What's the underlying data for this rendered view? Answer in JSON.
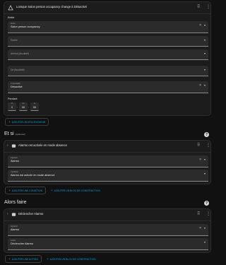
{
  "triggers": {
    "card_title": "Lorsque Salon person occupancy change à Désactivé",
    "entity_label": "Entité",
    "entity_field": {
      "label": "Entité",
      "value": "Salon person occupancy"
    },
    "from_field": {
      "placeholder": "Entrée"
    },
    "attribute_field": {
      "placeholder": "Attribut (facultatif)"
    },
    "de_field": {
      "placeholder": "De (facultatif)"
    },
    "to_field": {
      "label": "À (facultatif)",
      "value": "Désactivé"
    },
    "duration_label": "Pendant",
    "duration": [
      {
        "unit": "hh",
        "value": "0"
      },
      {
        "unit": "mm",
        "value": "00"
      },
      {
        "unit": "ss",
        "value": "00"
      }
    ],
    "add_button": "AJOUTER UN DÉCLENCHEUR"
  },
  "conditions": {
    "heading": "Et si",
    "heading_suffix": "(optionnel)",
    "card_title": "Alarmo est activée en mode absence",
    "device_field": {
      "label": "Appareil",
      "value": "Alarmo"
    },
    "condition_field": {
      "label": "Condition",
      "value": "Alarmo est activée en mode absence"
    },
    "add_button": "AJOUTER UNE CONDITION",
    "add_block_button": "AJOUTER UN BLOC DE CONSTRUCTION"
  },
  "actions": {
    "heading": "Alors faire",
    "card_title": "Déclencher Alarmo",
    "device_field": {
      "label": "Appareil",
      "value": "Alarmo"
    },
    "action_field": {
      "label": "Action",
      "value": "Déclencher Alarmo"
    },
    "add_button": "AJOUTER UNE ACTION",
    "add_block_button": "AJOUTER UN BLOC DE CONSTRUCTION"
  },
  "icons": {
    "trigger": "state-trigger-icon",
    "condition": "device-condition-icon",
    "action": "device-action-icon",
    "help": "help-circle-icon"
  },
  "colors": {
    "accent": "#03a9f4",
    "card": "#1c1c1c",
    "background": "#111111"
  }
}
